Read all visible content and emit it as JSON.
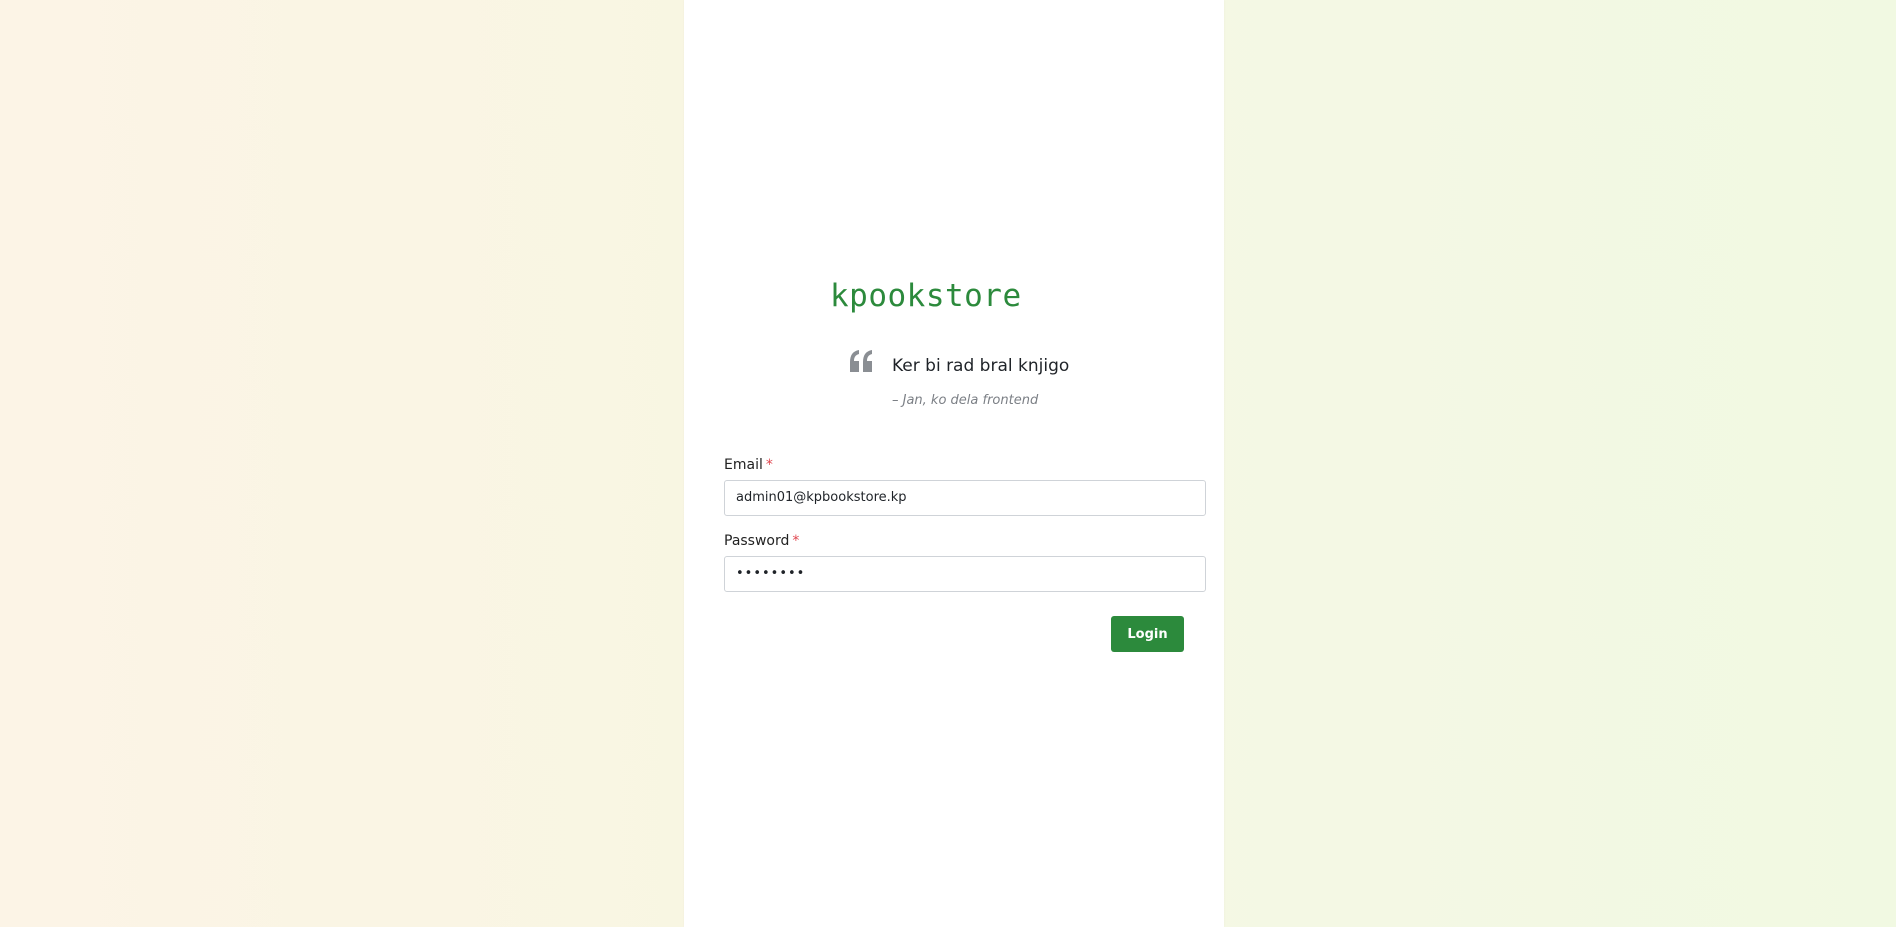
{
  "brand": {
    "name": "kpookstore",
    "color": "#2c8a3c"
  },
  "quote": {
    "icon": "quote-icon",
    "text": "Ker bi rad bral knjigo",
    "author": "– Jan, ko dela frontend"
  },
  "form": {
    "email": {
      "label": "Email",
      "required_mark": "*",
      "value": "admin01@kpbookstore.kp"
    },
    "password": {
      "label": "Password",
      "required_mark": "*",
      "value": "••••••••"
    },
    "submit_label": "Login"
  },
  "colors": {
    "accent": "#2c8a3c",
    "required": "#e0464f"
  }
}
